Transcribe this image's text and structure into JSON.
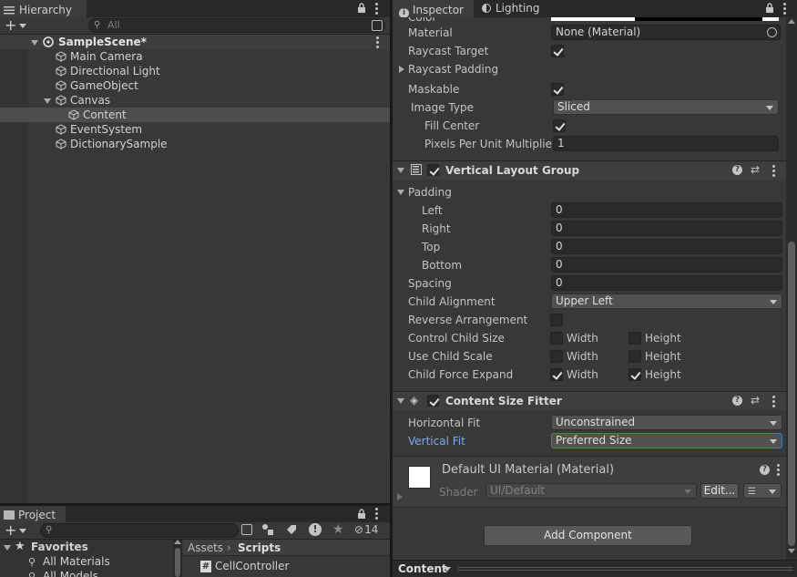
{
  "hierarchy": {
    "tab_label": "Hierarchy",
    "search_placeholder": "All",
    "scene_name": "SampleScene*",
    "items": [
      {
        "label": "Main Camera"
      },
      {
        "label": "Directional Light"
      },
      {
        "label": "GameObject"
      },
      {
        "label": "Canvas"
      },
      {
        "label": "Content"
      },
      {
        "label": "EventSystem"
      },
      {
        "label": "DictionarySample"
      }
    ]
  },
  "inspector": {
    "tab_inspector": "Inspector",
    "tab_lighting": "Lighting",
    "image": {
      "color_label": "Color",
      "material_label": "Material",
      "material_value": "None (Material)",
      "raycast_target_label": "Raycast Target",
      "raycast_target": true,
      "raycast_padding_label": "Raycast Padding",
      "maskable_label": "Maskable",
      "maskable": true,
      "image_type_label": "Image Type",
      "image_type_value": "Sliced",
      "fill_center_label": "Fill Center",
      "fill_center": true,
      "ppu_label": "Pixels Per Unit Multiplier",
      "ppu_value": "1"
    },
    "vlg": {
      "title": "Vertical Layout Group",
      "enabled": true,
      "padding_label": "Padding",
      "left_label": "Left",
      "left_value": "0",
      "right_label": "Right",
      "right_value": "0",
      "top_label": "Top",
      "top_value": "0",
      "bottom_label": "Bottom",
      "bottom_value": "0",
      "spacing_label": "Spacing",
      "spacing_value": "0",
      "child_alignment_label": "Child Alignment",
      "child_alignment_value": "Upper Left",
      "reverse_label": "Reverse Arrangement",
      "control_child_size_label": "Control Child Size",
      "use_child_scale_label": "Use Child Scale",
      "child_force_expand_label": "Child Force Expand",
      "width_label": "Width",
      "height_label": "Height"
    },
    "csf": {
      "title": "Content Size Fitter",
      "enabled": true,
      "horizontal_fit_label": "Horizontal Fit",
      "horizontal_fit_value": "Unconstrained",
      "vertical_fit_label": "Vertical Fit",
      "vertical_fit_value": "Preferred Size"
    },
    "material": {
      "title": "Default UI Material (Material)",
      "shader_label": "Shader",
      "shader_value": "UI/Default",
      "edit_label": "Edit..."
    },
    "add_component_label": "Add Component",
    "footer_label": "Content"
  },
  "project": {
    "tab_label": "Project",
    "badge_count": "14",
    "favorites_label": "Favorites",
    "fav_items": [
      "All Materials",
      "All Models"
    ],
    "breadcrumb_root": "Assets",
    "breadcrumb_sep": "›",
    "breadcrumb_current": "Scripts",
    "files": [
      "CellController"
    ]
  },
  "colors": {
    "accent_blue": "#7babf0",
    "panel_bg": "#383838",
    "selected_row": "#4d4d4d",
    "focus_border": "#3a79bb"
  }
}
